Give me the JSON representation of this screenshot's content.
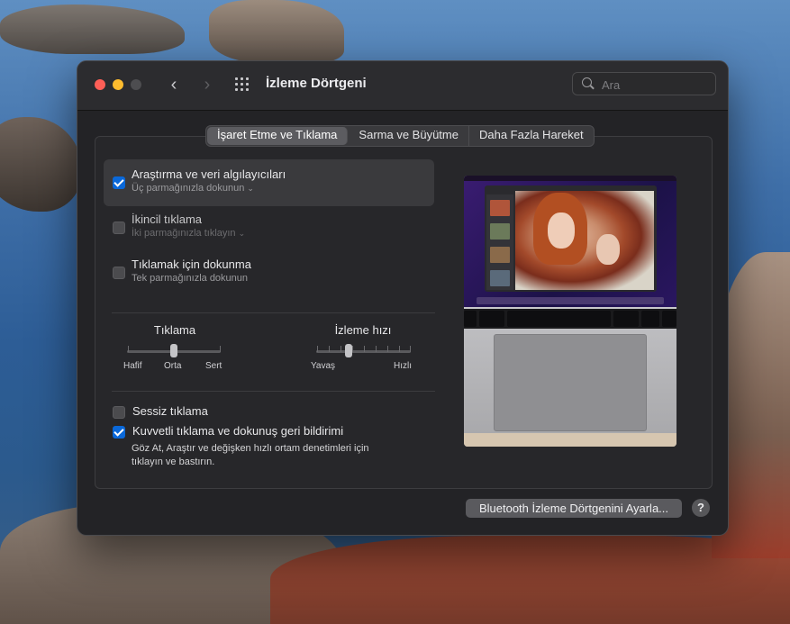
{
  "window": {
    "title": "İzleme Dörtgeni",
    "search_placeholder": "Ara"
  },
  "tabs": [
    {
      "label": "İşaret Etme ve Tıklama",
      "active": true
    },
    {
      "label": "Sarma ve Büyütme",
      "active": false
    },
    {
      "label": "Daha Fazla Hareket",
      "active": false
    }
  ],
  "options": [
    {
      "title": "Araştırma ve veri algılayıcıları",
      "subtitle": "Üç parmağınızla dokunun",
      "checked": true,
      "has_dropdown": true
    },
    {
      "title": "İkincil tıklama",
      "subtitle": "İki parmağınızla tıklayın",
      "checked": false,
      "has_dropdown": true
    },
    {
      "title": "Tıklamak için dokunma",
      "subtitle": "Tek parmağınızla dokunun",
      "checked": false,
      "has_dropdown": false
    }
  ],
  "sliders": {
    "click": {
      "label": "Tıklama",
      "min_label": "Hafif",
      "mid_label": "Orta",
      "max_label": "Sert",
      "value_fraction": 0.5
    },
    "tracking": {
      "label": "İzleme hızı",
      "min_label": "Yavaş",
      "max_label": "Hızlı",
      "value_fraction": 0.3
    }
  },
  "bottom_checks": {
    "silent": {
      "label": "Sessiz tıklama",
      "checked": false
    },
    "force": {
      "label": "Kuvvetli tıklama ve dokunuş geri bildirimi",
      "checked": true
    }
  },
  "description": "Göz At, Araştır ve değişken hızlı ortam denetimleri için tıklayın ve bastırın.",
  "bluetooth_button": "Bluetooth İzleme Dörtgenini Ayarla...",
  "help_label": "?",
  "colors": {
    "accent": "#0a68d9",
    "window_bg": "#232326",
    "close": "#fe5f57",
    "minimize": "#febc2e"
  },
  "icons": {
    "back": "chevron-left-icon",
    "forward": "chevron-right-icon",
    "grid": "grid-icon",
    "search": "search-icon"
  }
}
